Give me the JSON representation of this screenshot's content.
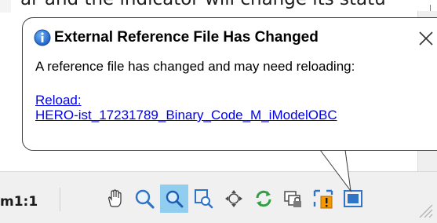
{
  "background": {
    "cropped_text": "ar and the indicator will change its statu"
  },
  "balloon": {
    "title": "External Reference File Has Changed",
    "message": "A reference file has changed and may need reloading:",
    "link_line1": "Reload:",
    "link_line2": "HERO-ist_17231789_Binary_Code_M_iModelOBC",
    "info_icon": "info-icon",
    "close_icon": "close-icon"
  },
  "statusbar": {
    "scale": "m1:1",
    "tools": [
      {
        "icon": "hand-pan-icon"
      },
      {
        "icon": "zoom-icon"
      },
      {
        "icon": "zoom-active-icon",
        "active": true
      },
      {
        "icon": "zoom-window-icon"
      },
      {
        "icon": "orbit-icon"
      },
      {
        "icon": "refresh-icon"
      },
      {
        "icon": "xref-lock-icon"
      },
      {
        "icon": "xref-alert-icon"
      },
      {
        "icon": "fullscreen-icon"
      }
    ]
  },
  "colors": {
    "link": "#0000ee",
    "info_blue": "#1e6fd0",
    "active_tool_bg": "#90cdee",
    "alert_orange": "#f29900"
  }
}
